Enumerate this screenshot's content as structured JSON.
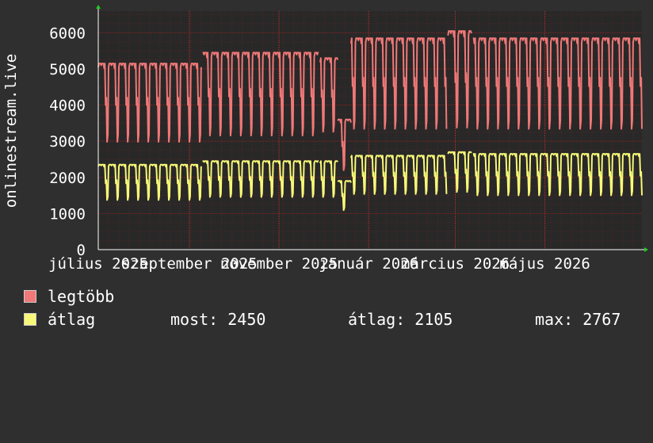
{
  "chart_data": {
    "type": "line",
    "ylabel": "onlinestream.live",
    "ylim": [
      0,
      6600
    ],
    "yticks": [
      0,
      1000,
      2000,
      3000,
      4000,
      5000,
      6000
    ],
    "xticks": [
      "július 2025",
      "szeptember 2025",
      "november 2025",
      "január 2026",
      "március 2026",
      "május 2026"
    ],
    "xrange_days": [
      0,
      370
    ],
    "xtick_days": [
      0,
      62,
      123,
      184,
      243,
      304
    ],
    "grid": true,
    "series": [
      {
        "name": "legtöbb",
        "color": "#f07878",
        "segments": [
          {
            "start": 0,
            "end": 70,
            "peak": 5150,
            "low": 2600
          },
          {
            "start": 71,
            "end": 150,
            "peak": 5450,
            "low": 2750
          },
          {
            "start": 151,
            "end": 163,
            "peak": 5300,
            "low": 2900
          },
          {
            "start": 163,
            "end": 172,
            "peak": 3600,
            "low": 1950
          },
          {
            "start": 172,
            "end": 237,
            "peak": 5850,
            "low": 2900
          },
          {
            "start": 238,
            "end": 254,
            "peak": 6050,
            "low": 2900
          },
          {
            "start": 255,
            "end": 370,
            "peak": 5850,
            "low": 2900
          }
        ]
      },
      {
        "name": "átlag",
        "color": "#f8f878",
        "segments": [
          {
            "start": 0,
            "end": 70,
            "peak": 2350,
            "low": 1200
          },
          {
            "start": 71,
            "end": 150,
            "peak": 2450,
            "low": 1280
          },
          {
            "start": 151,
            "end": 163,
            "peak": 2450,
            "low": 1280
          },
          {
            "start": 163,
            "end": 172,
            "peak": 1900,
            "low": 950
          },
          {
            "start": 172,
            "end": 237,
            "peak": 2600,
            "low": 1350
          },
          {
            "start": 238,
            "end": 254,
            "peak": 2700,
            "low": 1400
          },
          {
            "start": 255,
            "end": 370,
            "peak": 2650,
            "low": 1300
          }
        ]
      }
    ]
  },
  "legend": {
    "max_label": "legtöbb",
    "avg_label": "átlag",
    "now": "most: 2450",
    "average": "átlag: 2105",
    "maximum": "max: 2767"
  },
  "colors": {
    "background": "#2f2f2f",
    "plot_bg": "#282828",
    "grid": "#8a2a2a"
  }
}
